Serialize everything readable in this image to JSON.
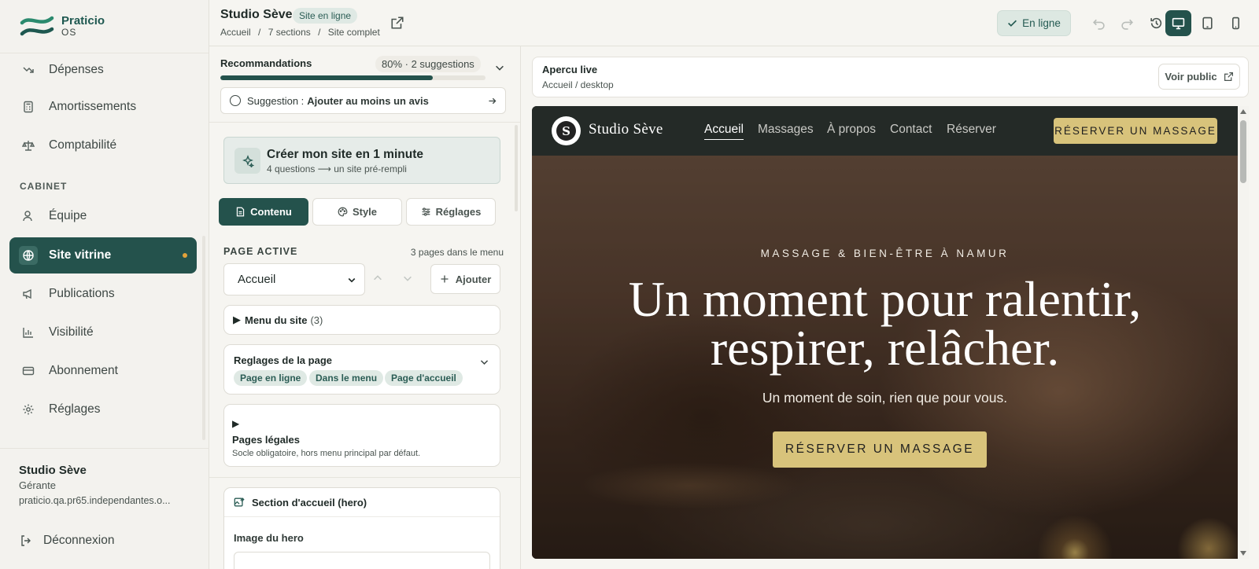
{
  "brand": {
    "name": "Praticio",
    "sub": "OS"
  },
  "sidebar": {
    "items": [
      {
        "label": "Dépenses",
        "icon": "trending-down-icon"
      },
      {
        "label": "Amortissements",
        "icon": "calculator-icon"
      },
      {
        "label": "Comptabilité",
        "icon": "scale-icon"
      }
    ],
    "section_label": "CABINET",
    "cabinet_items": [
      {
        "label": "Équipe",
        "icon": "user-icon"
      },
      {
        "label": "Site vitrine",
        "icon": "globe-icon",
        "active": true
      },
      {
        "label": "Publications",
        "icon": "megaphone-icon"
      },
      {
        "label": "Visibilité",
        "icon": "bar-chart-icon"
      },
      {
        "label": "Abonnement",
        "icon": "credit-card-icon"
      },
      {
        "label": "Réglages",
        "icon": "gear-icon"
      }
    ],
    "user": {
      "name": "Studio Sève",
      "role": "Gérante",
      "url": "praticio.qa.pr65.independantes.o..."
    },
    "logout_label": "Déconnexion"
  },
  "topbar": {
    "site_title": "Studio Sève",
    "status_badge": "Site en ligne",
    "breadcrumb": [
      "Accueil",
      "/",
      "7 sections",
      "/",
      "Site complet"
    ],
    "online_label": "En ligne"
  },
  "editor": {
    "reco_title": "Recommandations",
    "reco_badge": "80% · 2 suggestions",
    "reco_progress": 0.8,
    "suggestion_prefix": "Suggestion :",
    "suggestion_text": "Ajouter au moins un avis",
    "quick_title": "Créer mon site en 1 minute",
    "quick_sub": "4 questions ⟶ un site pré-rempli",
    "tabs": [
      "Contenu",
      "Style",
      "Réglages"
    ],
    "page_active_label": "PAGE ACTIVE",
    "page_count": "3 pages dans le menu",
    "page_select_value": "Accueil",
    "add_label": "Ajouter",
    "menu_label": "Menu du site",
    "menu_count": "(3)",
    "settings_title": "Reglages de la page",
    "settings_tags": [
      "Page en ligne",
      "Dans le menu",
      "Page d'accueil"
    ],
    "legal_title": "Pages légales",
    "legal_sub": "Socle obligatoire, hors menu principal par défaut.",
    "hero_section_title": "Section d'accueil (hero)",
    "hero_image_label": "Image du hero"
  },
  "preview": {
    "title": "Apercu live",
    "sub": "Accueil / desktop",
    "public_label": "Voir public",
    "site": {
      "logo_letter": "S",
      "name": "Studio Sève",
      "nav": [
        "Accueil",
        "Massages",
        "À propos",
        "Contact",
        "Réserver"
      ],
      "cta": "RÉSERVER UN MASSAGE",
      "kicker": "MASSAGE & BIEN-ÊTRE À NAMUR",
      "title_line1": "Un moment pour ralentir,",
      "title_line2": "respirer, relâcher.",
      "subtitle": "Un moment de soin, rien que pour vous.",
      "hero_cta": "RÉSERVER UN MASSAGE"
    }
  },
  "colors": {
    "primary": "#24524c",
    "accent": "#d8c37b",
    "dot": "#e2a23a"
  }
}
